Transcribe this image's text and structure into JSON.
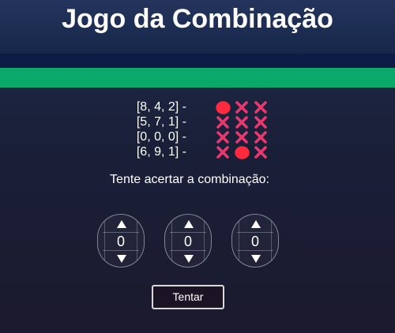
{
  "header": {
    "title": "Jogo da Combinação"
  },
  "colors": {
    "accent_green": "#0aa86a",
    "mark_red": "#ff2a3d",
    "mark_pink": "#e8386e"
  },
  "history": [
    {
      "guess": "[8, 4, 2] -",
      "marks": [
        "circle",
        "cross",
        "cross"
      ]
    },
    {
      "guess": "[5, 7, 1] -",
      "marks": [
        "cross",
        "cross",
        "cross"
      ]
    },
    {
      "guess": "[0, 0, 0] -",
      "marks": [
        "cross",
        "cross",
        "cross"
      ]
    },
    {
      "guess": "[6, 9, 1] -",
      "marks": [
        "cross",
        "circle",
        "cross"
      ]
    }
  ],
  "prompt": "Tente acertar a combinação:",
  "digits": [
    {
      "value": "0",
      "up_icon": "arrow-up-icon",
      "down_icon": "arrow-down-icon"
    },
    {
      "value": "0",
      "up_icon": "arrow-up-icon",
      "down_icon": "arrow-down-icon"
    },
    {
      "value": "0",
      "up_icon": "arrow-up-icon",
      "down_icon": "arrow-down-icon"
    }
  ],
  "try_button": {
    "label": "Tentar"
  }
}
